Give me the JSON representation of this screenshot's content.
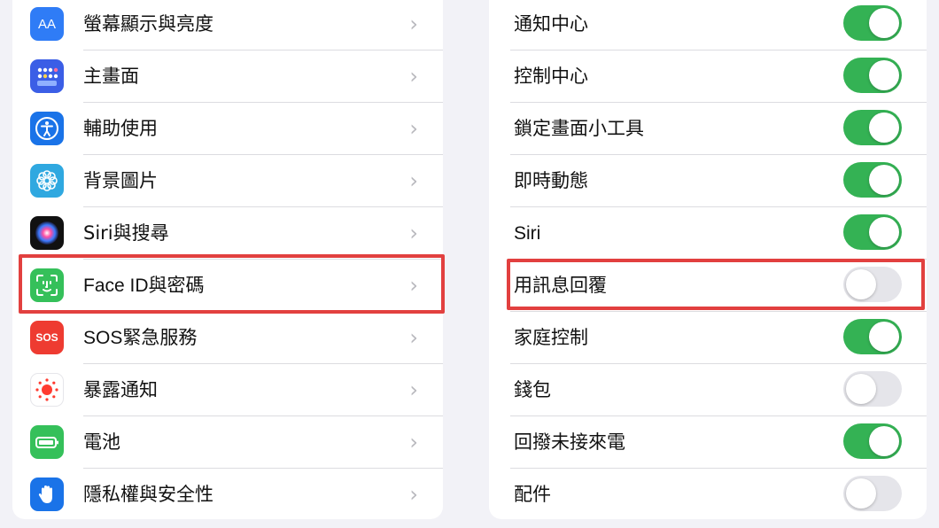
{
  "colors": {
    "toggle_on": "#34b254",
    "toggle_off": "#e5e5ea",
    "highlight": "#e2403f"
  },
  "left_menu": [
    {
      "label": "螢幕顯示與亮度",
      "icon": "display-brightness-icon",
      "icon_text": "AA"
    },
    {
      "label": "主畫面",
      "icon": "home-screen-icon"
    },
    {
      "label": "輔助使用",
      "icon": "accessibility-icon"
    },
    {
      "label": "背景圖片",
      "icon": "wallpaper-icon"
    },
    {
      "label": "Siri與搜尋",
      "icon": "siri-icon"
    },
    {
      "label": "Face ID與密碼",
      "icon": "face-id-icon",
      "highlighted": true
    },
    {
      "label": "SOS緊急服務",
      "icon": "sos-icon",
      "icon_text": "SOS"
    },
    {
      "label": "暴露通知",
      "icon": "exposure-notification-icon"
    },
    {
      "label": "電池",
      "icon": "battery-icon"
    },
    {
      "label": "隱私權與安全性",
      "icon": "privacy-hand-icon"
    }
  ],
  "right_toggles": [
    {
      "label": "通知中心",
      "on": true
    },
    {
      "label": "控制中心",
      "on": true
    },
    {
      "label": "鎖定畫面小工具",
      "on": true
    },
    {
      "label": "即時動態",
      "on": true
    },
    {
      "label": "Siri",
      "on": true
    },
    {
      "label": "用訊息回覆",
      "on": false,
      "highlighted": true
    },
    {
      "label": "家庭控制",
      "on": true
    },
    {
      "label": "錢包",
      "on": false
    },
    {
      "label": "回撥未接來電",
      "on": true
    },
    {
      "label": "配件",
      "on": false
    }
  ]
}
